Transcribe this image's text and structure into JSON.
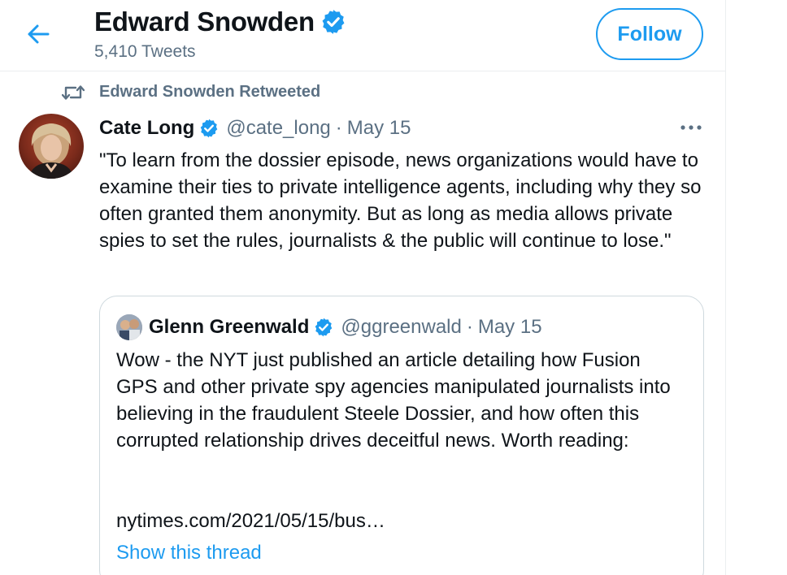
{
  "header": {
    "name": "Edward Snowden",
    "tweet_count": "5,410 Tweets",
    "follow_label": "Follow"
  },
  "retweet_context": {
    "label": "Edward Snowden Retweeted"
  },
  "tweet": {
    "author_name": "Cate Long",
    "author_handle": "@cate_long",
    "separator": "·",
    "date": "May 15",
    "text": "\"To learn from the dossier episode, news organizations would have to examine their ties to private intelligence agents, including why they so often granted them anonymity. But as long as media allows private spies to set the rules, journalists & the public will continue to lose.\""
  },
  "quote": {
    "author_name": "Glenn Greenwald",
    "author_handle": "@ggreenwald",
    "separator": "·",
    "date": "May 15",
    "text": "Wow - the NYT just published an article detailing how Fusion GPS and other private spy agencies manipulated journalists into believing in the fraudulent Steele Dossier, and how often this corrupted relationship drives deceitful news. Worth reading:",
    "link": "nytimes.com/2021/05/15/bus…",
    "show_thread": "Show this thread"
  },
  "icons": {
    "back": "arrow-left-icon",
    "verified": "verified-badge-icon",
    "retweet": "retweet-icon",
    "more": "more-horizontal-icon"
  },
  "colors": {
    "accent": "#1d9bf0",
    "secondary_text": "#5b7083",
    "primary_text": "#0f1419",
    "border": "#cfd9de"
  }
}
